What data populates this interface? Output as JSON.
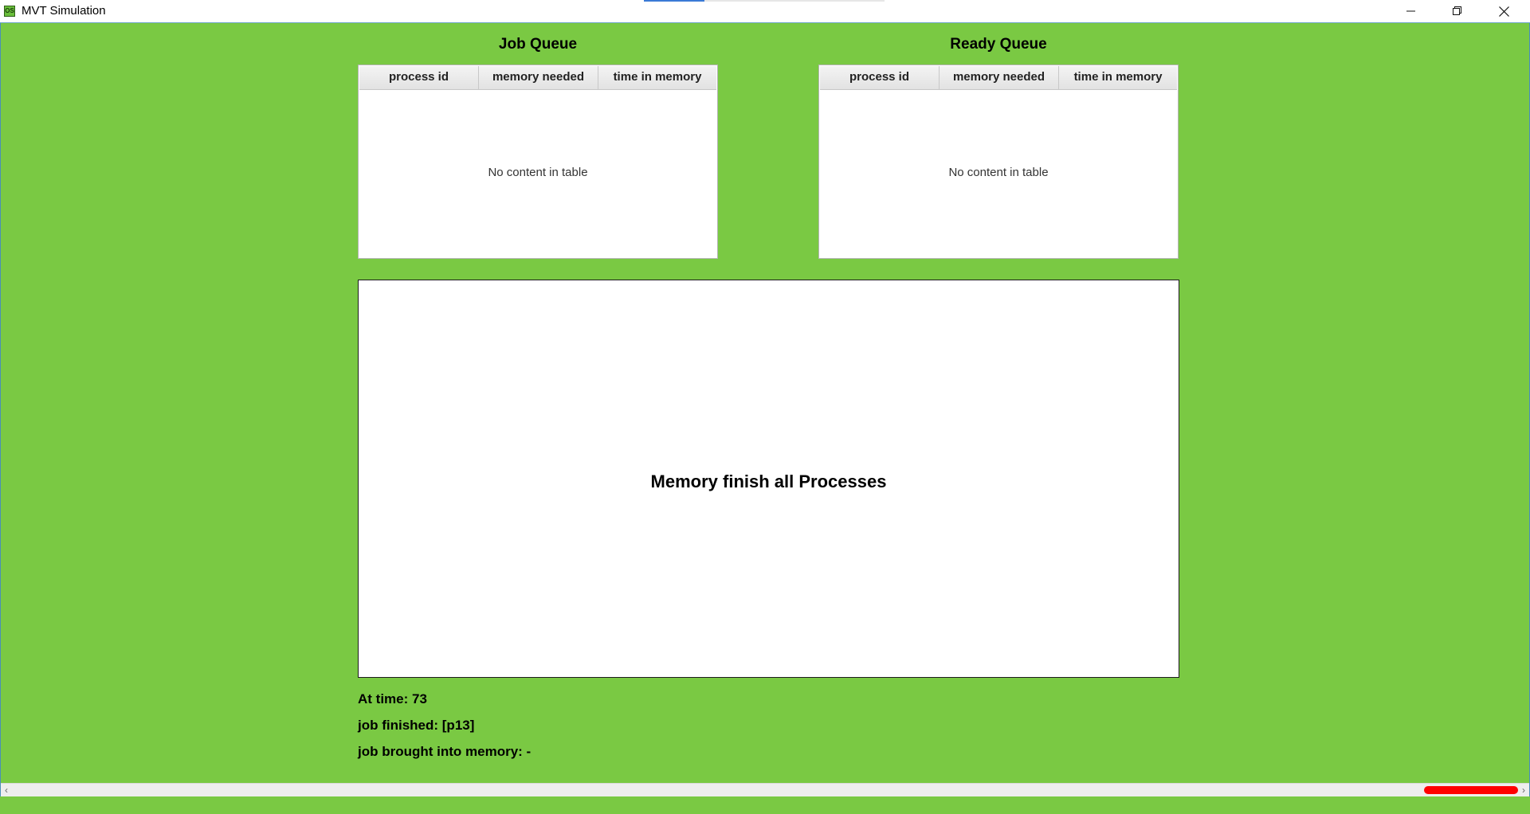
{
  "window": {
    "title": "MVT Simulation",
    "icon_text": "OS",
    "title_progress": 0.25
  },
  "job_queue": {
    "title": "Job Queue",
    "columns": [
      "process id",
      "memory needed",
      "time in memory"
    ],
    "rows": [],
    "empty_message": "No content in table"
  },
  "ready_queue": {
    "title": "Ready Queue",
    "columns": [
      "process id",
      "memory needed",
      "time in memory"
    ],
    "rows": [],
    "empty_message": "No content in table"
  },
  "memory": {
    "message": "Memory finish all Processes"
  },
  "status": {
    "time": "At time: 73",
    "finished": "job finished: [p13]",
    "brought_in": "job brought into memory: -"
  },
  "scrollbar": {
    "thumb_color": "#ff0000",
    "position": 1.0
  },
  "colors": {
    "background": "#7ac943",
    "accent": "#3a7ad6"
  }
}
